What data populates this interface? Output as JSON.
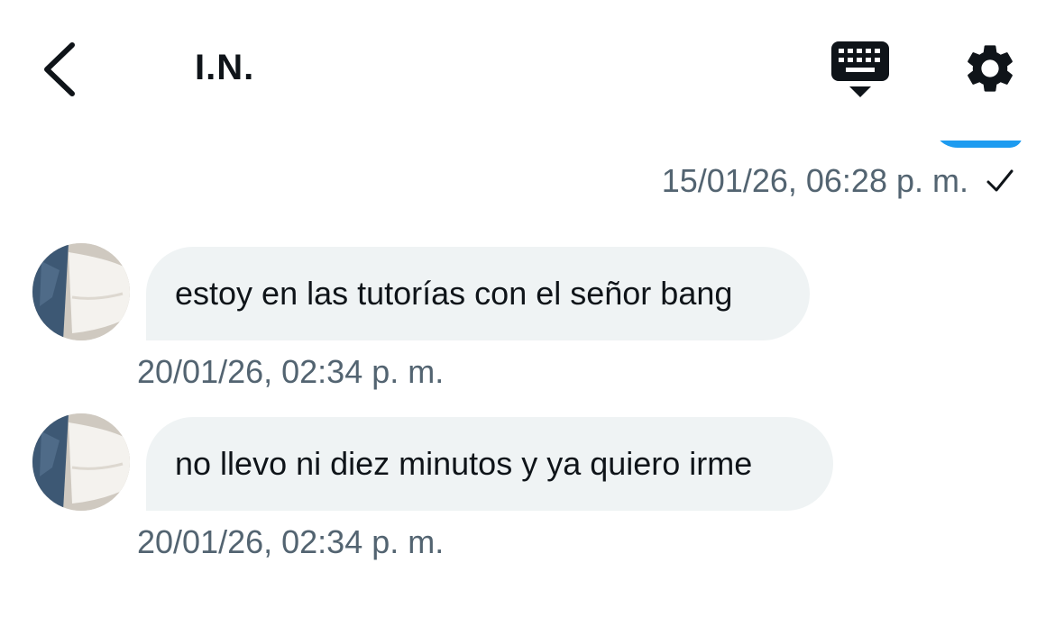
{
  "header": {
    "title": "I.N.",
    "back_icon": "chevron-left-icon",
    "keyboard_icon": "keyboard-icon",
    "settings_icon": "gear-icon"
  },
  "conversation": {
    "sent_message": {
      "timestamp": "15/01/26, 06:28 p. m.",
      "status_icon": "checkmark-icon"
    },
    "received_messages": [
      {
        "text": "estoy en las tutorías con el señor bang",
        "timestamp": "20/01/26, 02:34 p. m."
      },
      {
        "text": "no llevo ni diez minutos y ya quiero irme",
        "timestamp": "20/01/26, 02:34 p. m."
      }
    ]
  },
  "colors": {
    "accent": "#1d9bf0",
    "received_bubble": "#eff3f4",
    "secondary_text": "#536471",
    "primary_text": "#0f1419"
  }
}
